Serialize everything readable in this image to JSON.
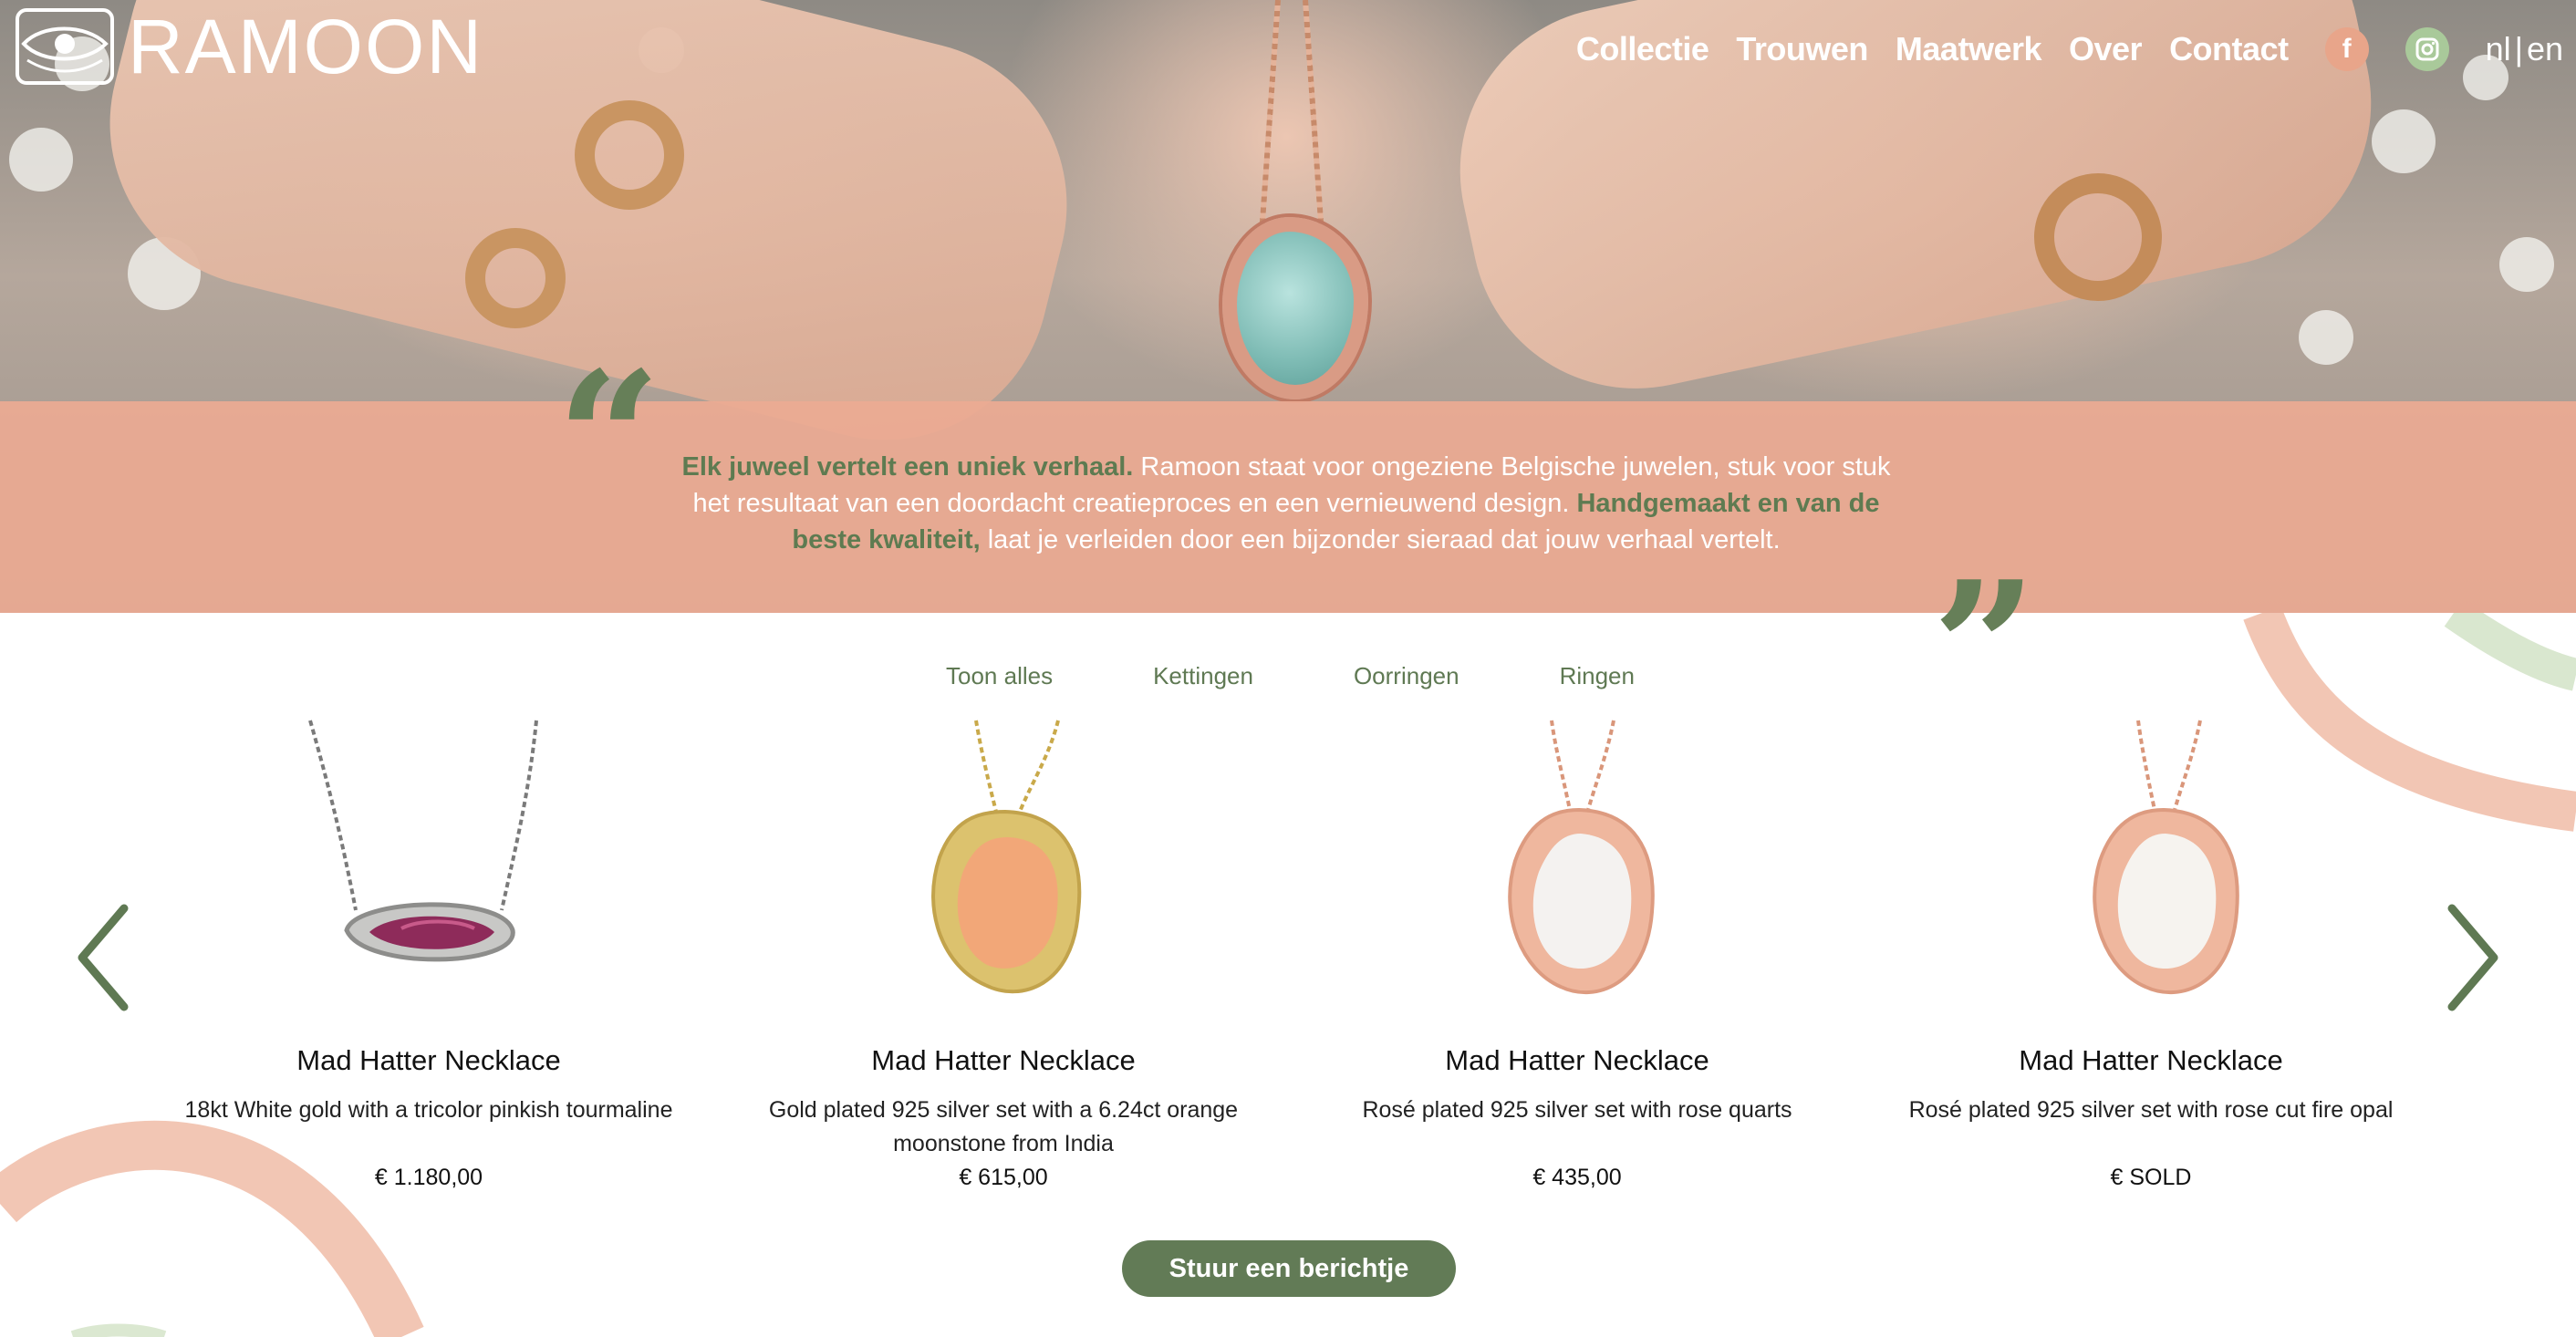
{
  "brand": {
    "name": "RAMOON"
  },
  "nav": {
    "items": [
      "Collectie",
      "Trouwen",
      "Maatwerk",
      "Over",
      "Contact"
    ],
    "facebook_glyph": "f",
    "lang_nl": "nl",
    "lang_sep": "|",
    "lang_en": "en"
  },
  "quote": {
    "open_mark": "“",
    "close_mark": "”",
    "part1_highlight": "Elk juweel vertelt een uniek verhaal.",
    "part2": " Ramoon staat voor ongeziene Belgische juwelen, stuk voor stuk het resultaat van een doordacht creatieproces en een vernieuwend design. ",
    "part3_highlight": "Handgemaakt en van de beste kwaliteit,",
    "part4": " laat je verleiden door een bijzonder sieraad dat jouw verhaal vertelt."
  },
  "filters": [
    "Toon alles",
    "Kettingen",
    "Oorringen",
    "Ringen"
  ],
  "products": [
    {
      "name": "Mad Hatter Necklace",
      "description": "18kt White gold with a tricolor pinkish tourmaline",
      "price": "€ 1.180,00"
    },
    {
      "name": "Mad Hatter Necklace",
      "description": "Gold plated 925 silver set with a 6.24ct orange moonstone from India",
      "price": "€ 615,00"
    },
    {
      "name": "Mad Hatter Necklace",
      "description": "Rosé plated 925 silver set with rose quarts",
      "price": "€ 435,00"
    },
    {
      "name": "Mad Hatter Necklace",
      "description": "Rosé plated 925 silver set with rose cut fire opal",
      "price": "€ SOLD"
    }
  ],
  "cta": {
    "label": "Stuur een berichtje"
  },
  "colors": {
    "accent_green": "#627b56",
    "band_peach": "#ecaa92",
    "curve_peach": "#f0c3b1",
    "curve_green": "#d6e5cb"
  },
  "icons": [
    "eye-logo-icon",
    "facebook-icon",
    "instagram-icon",
    "chevron-left-icon",
    "chevron-right-icon",
    "quote-open-icon",
    "quote-close-icon"
  ]
}
